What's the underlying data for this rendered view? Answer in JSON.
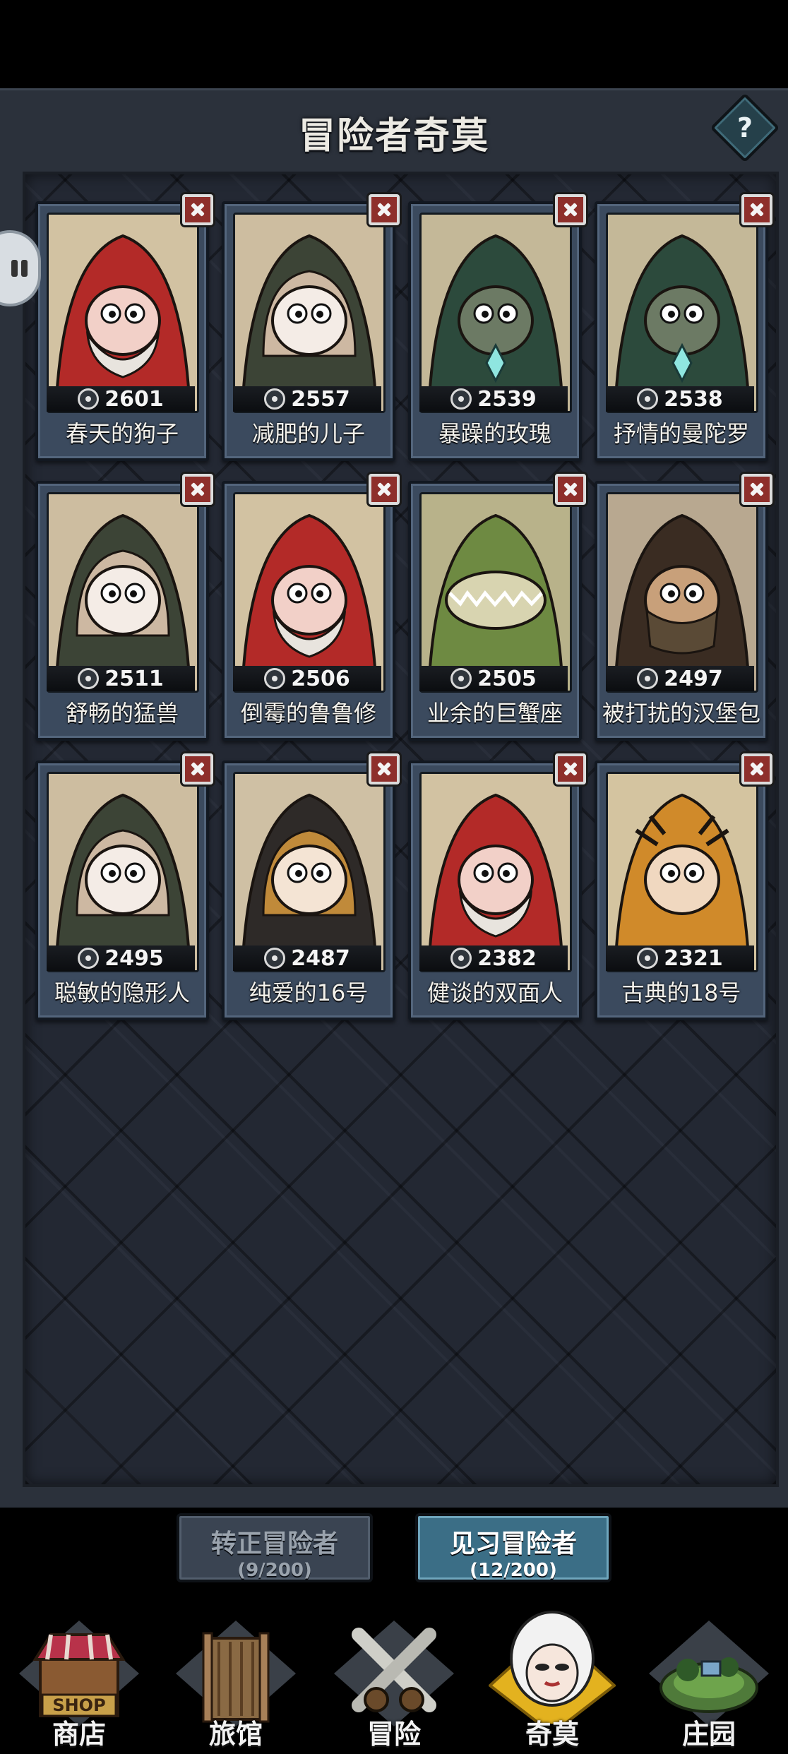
{
  "title": "冒险者奇莫",
  "help_label": "?",
  "cards": [
    {
      "name": "春天的狗子",
      "power": "2601",
      "skin": "red-hood",
      "class_icon": "target-icon"
    },
    {
      "name": "减肥的儿子",
      "power": "2557",
      "skin": "bear-hood",
      "class_icon": "brush-icon"
    },
    {
      "name": "暴躁的玫瑰",
      "power": "2539",
      "skin": "green-hood",
      "class_icon": "target-icon"
    },
    {
      "name": "抒情的曼陀罗",
      "power": "2538",
      "skin": "green-hood",
      "class_icon": "target-icon"
    },
    {
      "name": "舒畅的猛兽",
      "power": "2511",
      "skin": "bear-hood",
      "class_icon": "wrench-icon"
    },
    {
      "name": "倒霉的鲁鲁修",
      "power": "2506",
      "skin": "red-hood",
      "class_icon": "brush-icon"
    },
    {
      "name": "业余的巨蟹座",
      "power": "2505",
      "skin": "crocodile",
      "class_icon": "wrench-icon"
    },
    {
      "name": "被打扰的汉堡包",
      "power": "2497",
      "skin": "goggles",
      "class_icon": "target-icon"
    },
    {
      "name": "聪敏的隐形人",
      "power": "2495",
      "skin": "bear-hood",
      "class_icon": "wrench-icon"
    },
    {
      "name": "纯爱的16号",
      "power": "2487",
      "skin": "braids",
      "class_icon": "target-icon"
    },
    {
      "name": "健谈的双面人",
      "power": "2382",
      "skin": "red-hood",
      "class_icon": "brush-icon"
    },
    {
      "name": "古典的18号",
      "power": "2321",
      "skin": "tiger",
      "class_icon": "target-icon"
    }
  ],
  "tabs": [
    {
      "label": "转正冒险者",
      "count": "(9/200)",
      "active": false
    },
    {
      "label": "见习冒险者",
      "count": "(12/200)",
      "active": true
    }
  ],
  "nav": [
    {
      "label": "商店",
      "icon": "shop-icon",
      "sign": "SHOP"
    },
    {
      "label": "旅馆",
      "icon": "tavern-icon"
    },
    {
      "label": "冒险",
      "icon": "crossed-swords-icon"
    },
    {
      "label": "奇莫",
      "icon": "chimo-icon",
      "active": true
    },
    {
      "label": "庄园",
      "icon": "manor-icon"
    }
  ],
  "colors": {
    "panel": "#2b313b",
    "card": "#3b4a5e",
    "close": "#8e2f2b",
    "active_tab": "#3b6e86",
    "active_nav": "#e3b21f"
  }
}
